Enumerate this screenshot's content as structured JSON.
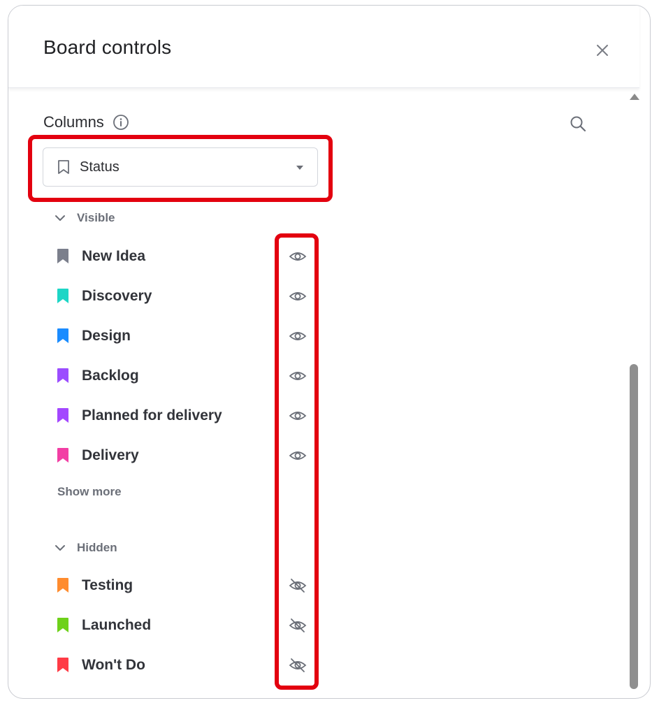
{
  "header": {
    "title": "Board controls",
    "close_icon": "close-icon"
  },
  "columns_section": {
    "title": "Columns",
    "info_icon": "info-icon",
    "search_icon": "search-icon"
  },
  "status_select": {
    "icon": "bookmark-outline-icon",
    "value": "Status",
    "caret_icon": "caret-down-icon"
  },
  "visible_group": {
    "label": "Visible",
    "items": [
      {
        "label": "New Idea",
        "color": "#7b7f8c"
      },
      {
        "label": "Discovery",
        "color": "#1dd6c6"
      },
      {
        "label": "Design",
        "color": "#1a8cff"
      },
      {
        "label": "Backlog",
        "color": "#9b4dff"
      },
      {
        "label": "Planned for delivery",
        "color": "#a347ff"
      },
      {
        "label": "Delivery",
        "color": "#f23ea4"
      }
    ],
    "show_more": "Show more"
  },
  "hidden_group": {
    "label": "Hidden",
    "items": [
      {
        "label": "Testing",
        "color": "#ff8c2e"
      },
      {
        "label": "Launched",
        "color": "#6ed11a"
      },
      {
        "label": "Won't Do",
        "color": "#ff3b45"
      }
    ]
  },
  "colors": {
    "highlight": "#e3000f",
    "text": "#32343a",
    "muted": "#6b6f78"
  }
}
